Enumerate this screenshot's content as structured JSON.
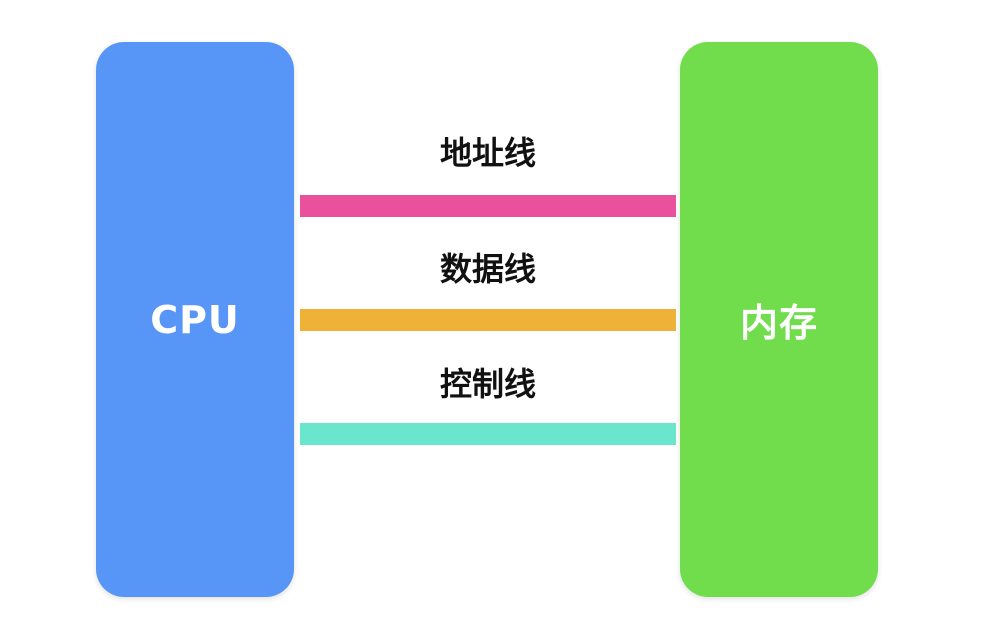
{
  "cpu": {
    "label": "CPU",
    "color": "#5795f7"
  },
  "memory": {
    "label": "内存",
    "color": "#71dc4c"
  },
  "buses": [
    {
      "label": "地址线",
      "color": "#ea519c"
    },
    {
      "label": "数据线",
      "color": "#efb238"
    },
    {
      "label": "控制线",
      "color": "#69e6cb"
    }
  ]
}
